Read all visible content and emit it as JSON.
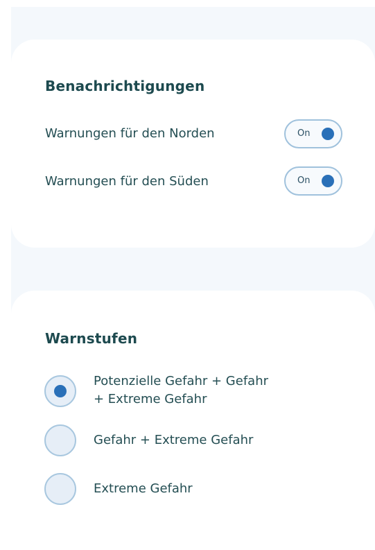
{
  "notifications": {
    "title": "Benachrichtigungen",
    "items": [
      {
        "label": "Warnungen für den Norden",
        "toggle_label": "On",
        "enabled": true
      },
      {
        "label": "Warnungen für den Süden",
        "toggle_label": "On",
        "enabled": true
      }
    ]
  },
  "warning_levels": {
    "title": "Warnstufen",
    "options": [
      {
        "line1": "Potenzielle Gefahr + Gefahr",
        "line2": "+ Extreme Gefahr",
        "selected": true
      },
      {
        "line1": "Gefahr + Extreme Gefahr",
        "selected": false
      },
      {
        "line1": "Extreme Gefahr",
        "selected": false
      }
    ]
  },
  "colors": {
    "accent": "#2a70b8",
    "text": "#244e53",
    "heading": "#1d4a4f",
    "background": "#f4f8fc"
  }
}
